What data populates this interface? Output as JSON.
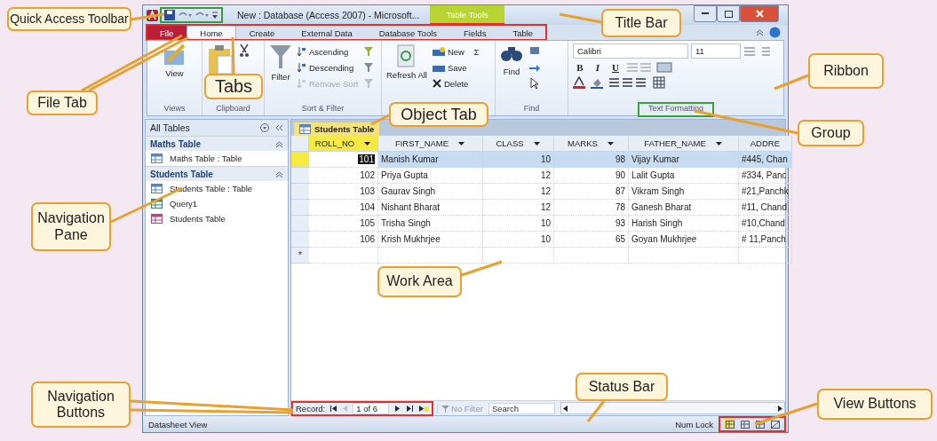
{
  "window": {
    "title": "New : Database (Access 2007) - Microsoft...",
    "context_tab": "Table Tools"
  },
  "ribbon_tabs": [
    {
      "label": "File",
      "kind": "file",
      "selected": false
    },
    {
      "label": "Home",
      "kind": "tab",
      "selected": true
    },
    {
      "label": "Create",
      "kind": "tab",
      "selected": false
    },
    {
      "label": "External Data",
      "kind": "tab",
      "selected": false
    },
    {
      "label": "Database Tools",
      "kind": "tab",
      "selected": false
    },
    {
      "label": "Fields",
      "kind": "tab",
      "selected": false
    },
    {
      "label": "Table",
      "kind": "tab",
      "selected": false
    }
  ],
  "ribbon": {
    "views": {
      "label": "Views",
      "button": "View"
    },
    "clipboard": {
      "label": "Clipboard"
    },
    "sort_filter": {
      "label": "Sort & Filter",
      "filter": "Filter",
      "items": [
        {
          "label": "Ascending",
          "disabled": false
        },
        {
          "label": "Descending",
          "disabled": false
        },
        {
          "label": "Remove Sort",
          "disabled": true
        }
      ]
    },
    "records": {
      "refresh": "Refresh All",
      "items": [
        {
          "label": "New",
          "kind": "new"
        },
        {
          "label": "Save",
          "kind": "save"
        },
        {
          "label": "Delete",
          "kind": "delete"
        }
      ],
      "sum": "Σ"
    },
    "find": {
      "label": "Find",
      "button": "Find"
    },
    "text_formatting": {
      "label": "Text Formatting",
      "font": "Calibri",
      "size": "11",
      "styles": [
        "B",
        "I",
        "U"
      ]
    }
  },
  "navigation_pane": {
    "title": "All Tables",
    "groups": [
      {
        "label": "Maths Table",
        "expanded": true,
        "children": [
          {
            "label": "Maths Table : Table",
            "kind": "table"
          }
        ]
      },
      {
        "label": "Students Table",
        "expanded": true,
        "children": [
          {
            "label": "Students Table : Table",
            "kind": "table"
          },
          {
            "label": "Query1",
            "kind": "query"
          },
          {
            "label": "Students Table",
            "kind": "form"
          }
        ]
      }
    ]
  },
  "object_tab": {
    "label": "Students Table"
  },
  "table": {
    "columns": [
      "ROLL_NO",
      "FIRST_NAME",
      "CLASS",
      "MARKS",
      "FATHER_NAME",
      "ADDRE"
    ],
    "rows": [
      {
        "selected": true,
        "cells": [
          "101",
          "Manish Kumar",
          "10",
          "98",
          "Vijay Kumar",
          "#445, Chan"
        ]
      },
      {
        "selected": false,
        "cells": [
          "102",
          "Priya Gupta",
          "12",
          "90",
          "Lalit Gupta",
          "#334, Panc"
        ]
      },
      {
        "selected": false,
        "cells": [
          "103",
          "Gaurav Singh",
          "12",
          "87",
          "Vikram Singh",
          "#21,Panchk"
        ]
      },
      {
        "selected": false,
        "cells": [
          "104",
          "Nishant Bharat",
          "12",
          "78",
          "Ganesh Bharat",
          "#11, Chand"
        ]
      },
      {
        "selected": false,
        "cells": [
          "105",
          "Trisha Singh",
          "10",
          "93",
          "Harish Singh",
          "#10,Chand"
        ]
      },
      {
        "selected": false,
        "cells": [
          "106",
          "Krish Mukhrjee",
          "10",
          "65",
          "Goyan Mukhrjee",
          "# 11,Panch"
        ]
      }
    ],
    "new_row_marker": "*"
  },
  "record_navigation": {
    "label": "Record:",
    "position": "1 of 6",
    "filter": "No Filter",
    "search": "Search"
  },
  "status_bar": {
    "view": "Datasheet View",
    "num_lock": "Num Lock",
    "view_buttons": [
      {
        "selected": true
      },
      {
        "selected": false
      },
      {
        "selected": false
      },
      {
        "selected": false
      }
    ]
  },
  "callouts": [
    {
      "text": "Quick Access Toolbar"
    },
    {
      "text": "File Tab"
    },
    {
      "text": "Tabs"
    },
    {
      "text": "Title Bar"
    },
    {
      "text": "Ribbon"
    },
    {
      "text": "Group"
    },
    {
      "text": "Object Tab"
    },
    {
      "text": "Navigation Pane"
    },
    {
      "text": "Work Area"
    },
    {
      "text": "Navigation Buttons"
    },
    {
      "text": "Status Bar"
    },
    {
      "text": "View Buttons"
    }
  ]
}
